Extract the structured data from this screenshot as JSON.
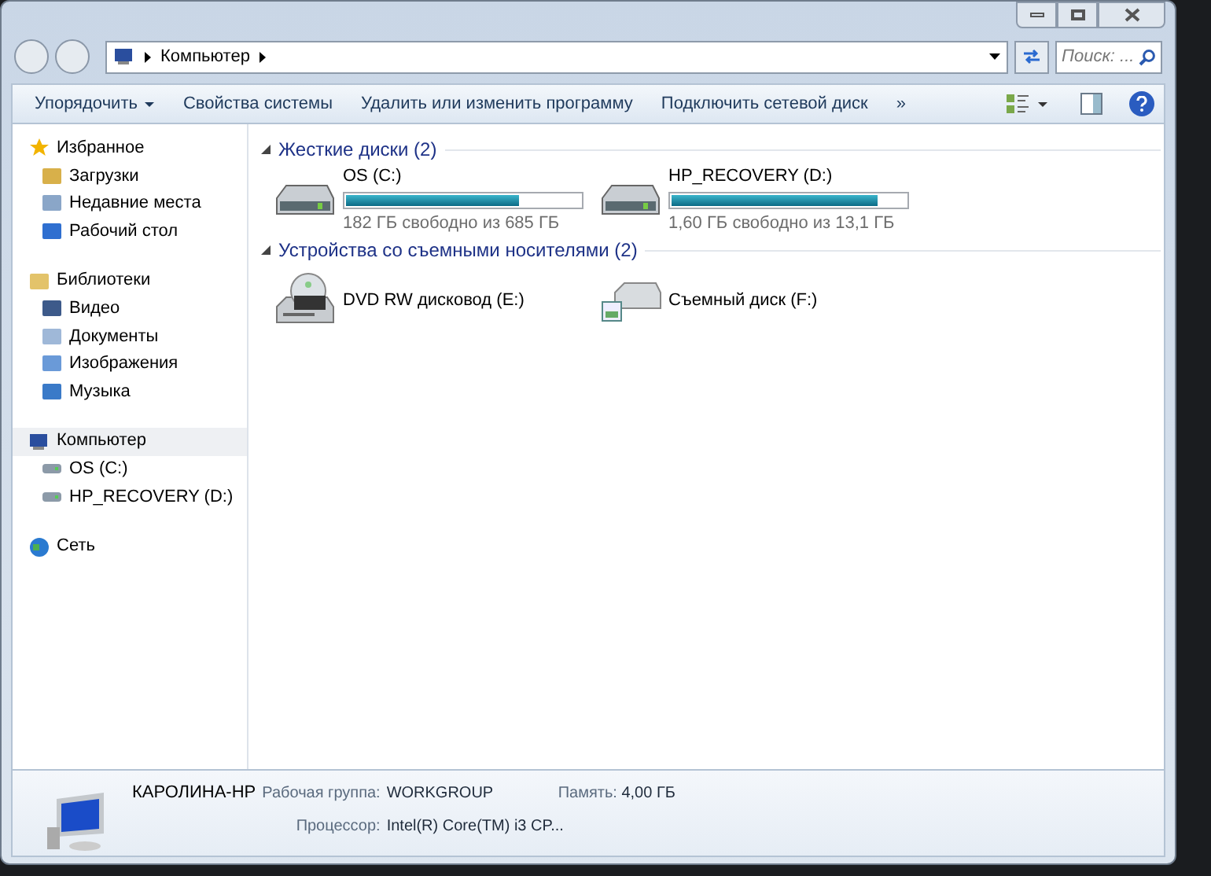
{
  "address": {
    "path": [
      "Компьютер"
    ]
  },
  "search": {
    "placeholder": "Поиск: ..."
  },
  "toolbar": [
    {
      "label": "Упорядочить",
      "dropdown": true
    },
    {
      "label": "Свойства системы",
      "dropdown": false
    },
    {
      "label": "Удалить или изменить программу",
      "dropdown": false
    },
    {
      "label": "Подключить сетевой диск",
      "dropdown": false
    },
    {
      "label": "»",
      "dropdown": false
    }
  ],
  "sidebar": [
    {
      "label": "Избранное",
      "selected": false,
      "children": [
        {
          "label": "Загрузки",
          "selected": false
        },
        {
          "label": "Недавние места",
          "selected": false
        },
        {
          "label": "Рабочий стол",
          "selected": false
        }
      ]
    },
    {
      "label": "Библиотеки",
      "selected": false,
      "children": [
        {
          "label": "Видео",
          "selected": false
        },
        {
          "label": "Документы",
          "selected": false
        },
        {
          "label": "Изображения",
          "selected": false
        },
        {
          "label": "Музыка",
          "selected": false
        }
      ]
    },
    {
      "label": "Компьютер",
      "selected": true,
      "children": [
        {
          "label": "OS (C:)",
          "selected": false
        },
        {
          "label": "HP_RECOVERY (D:)",
          "selected": false
        }
      ]
    },
    {
      "label": "Сеть",
      "selected": false
    }
  ],
  "groups": [
    {
      "title": "Жесткие диски (2)",
      "items": [
        {
          "kind": "hdd",
          "name": "OS (C:)",
          "level": 0.735,
          "free": "182 ГБ свободно из 685 ГБ"
        },
        {
          "kind": "hdd",
          "name": "HP_RECOVERY (D:)",
          "level": 0.878,
          "free": "1,60 ГБ свободно из 13,1 ГБ"
        }
      ]
    },
    {
      "title": "Устройства со съемными носителями (2)",
      "items": [
        {
          "kind": "dvd",
          "name": "DVD RW дисковод (E:)"
        },
        {
          "kind": "removable",
          "name": "Съемный диск (F:)"
        }
      ]
    }
  ],
  "details": {
    "name": "КАРОЛИНА-HP",
    "fields": [
      {
        "label": "Рабочая группа:",
        "value": "WORKGROUP"
      },
      {
        "label": "Память:",
        "value": "4,00 ГБ"
      },
      {
        "label": "Процессор:",
        "value": "Intel(R) Core(TM) i3 CP..."
      }
    ]
  }
}
